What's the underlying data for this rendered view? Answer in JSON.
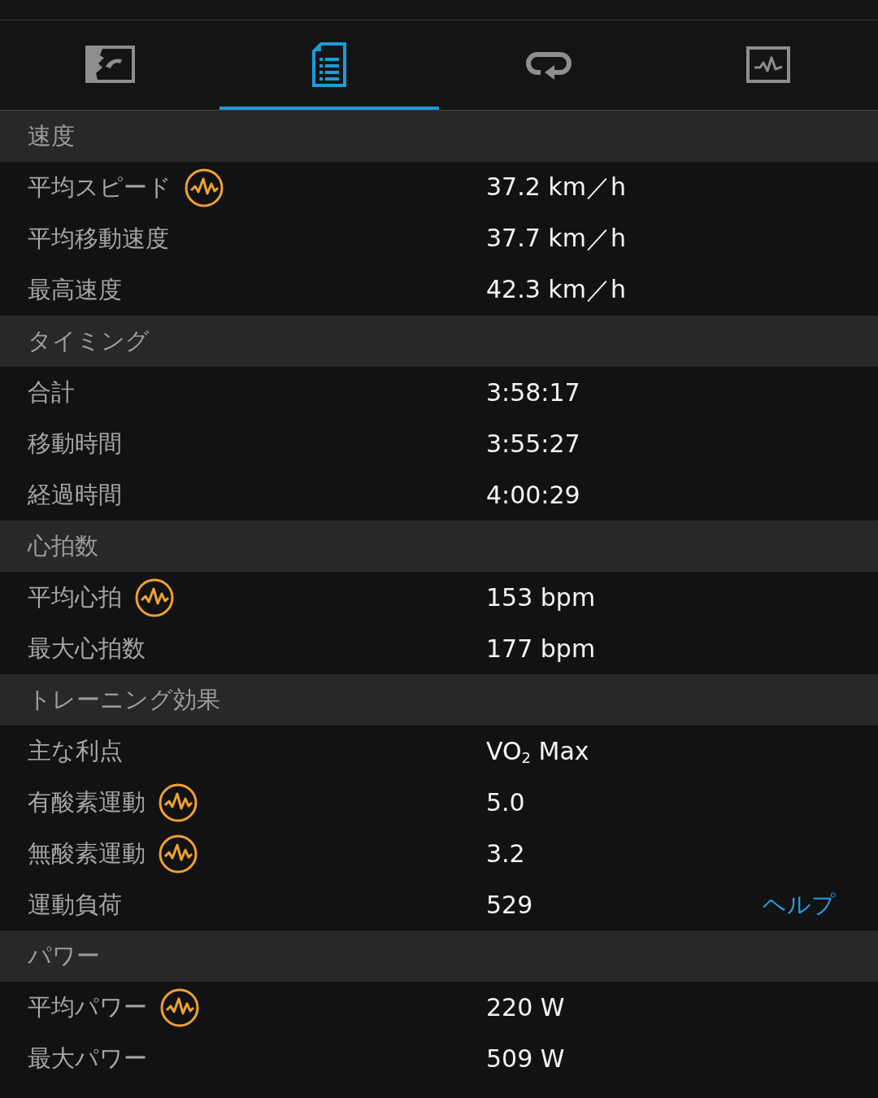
{
  "tabs": [
    {
      "kind": "map",
      "selected": false
    },
    {
      "kind": "details",
      "selected": true
    },
    {
      "kind": "laps",
      "selected": false
    },
    {
      "kind": "chart",
      "selected": false
    }
  ],
  "sections": [
    {
      "title": "速度",
      "rows": [
        {
          "label": "平均スピード",
          "badge": true,
          "value": "37.2 km／h"
        },
        {
          "label": "平均移動速度",
          "badge": false,
          "value": "37.7 km／h"
        },
        {
          "label": "最高速度",
          "badge": false,
          "value": "42.3 km／h"
        }
      ]
    },
    {
      "title": "タイミング",
      "rows": [
        {
          "label": "合計",
          "badge": false,
          "value": "3:58:17"
        },
        {
          "label": "移動時間",
          "badge": false,
          "value": "3:55:27"
        },
        {
          "label": "経過時間",
          "badge": false,
          "value": "4:00:29"
        }
      ]
    },
    {
      "title": "心拍数",
      "rows": [
        {
          "label": "平均心拍",
          "badge": true,
          "value": "153 bpm"
        },
        {
          "label": "最大心拍数",
          "badge": false,
          "value": "177 bpm"
        }
      ]
    },
    {
      "title": "トレーニング効果",
      "rows": [
        {
          "label": "主な利点",
          "badge": false,
          "value": "VO$_{2}$ Max"
        },
        {
          "label": "有酸素運動",
          "badge": true,
          "value": "5.0"
        },
        {
          "label": "無酸素運動",
          "badge": true,
          "value": "3.2"
        },
        {
          "label": "運動負荷",
          "badge": false,
          "value": "529",
          "link": "ヘルプ"
        }
      ]
    },
    {
      "title": "パワー",
      "rows": [
        {
          "label": "平均パワー",
          "badge": true,
          "value": "220 W"
        },
        {
          "label": "最大パワー",
          "badge": false,
          "value": "509 W"
        }
      ]
    }
  ]
}
